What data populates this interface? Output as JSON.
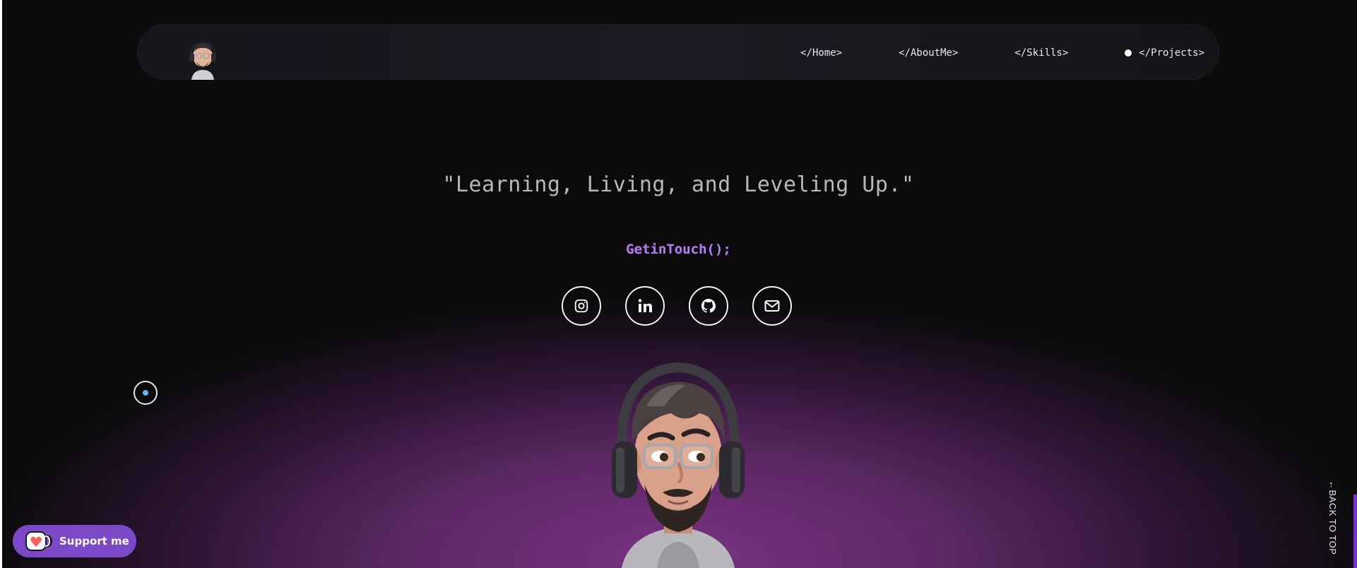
{
  "nav": {
    "links": [
      {
        "label": "</Home>",
        "active": false
      },
      {
        "label": "</AboutMe>",
        "active": false
      },
      {
        "label": "</Skills>",
        "active": false
      },
      {
        "label": "</Projects>",
        "active": true
      }
    ]
  },
  "hero": {
    "quote": "\"Learning, Living, and Leveling Up.\"",
    "cta_title": "GetinTouch();"
  },
  "socials": [
    {
      "icon": "instagram-icon"
    },
    {
      "icon": "linkedin-icon"
    },
    {
      "icon": "github-icon"
    },
    {
      "icon": "mail-icon"
    }
  ],
  "support": {
    "label": "Support me",
    "icon": "kofi-cup-icon",
    "color": "#7b49c8"
  },
  "back_to_top": {
    "label": "←BACK TO TOP"
  },
  "colors": {
    "background": "#0b0b0c",
    "accent_purple": "#7a3282",
    "cta_gradient_start": "#c17de8",
    "cta_gradient_end": "#9b7bf0",
    "cursor_dot": "#5fb8ff"
  }
}
